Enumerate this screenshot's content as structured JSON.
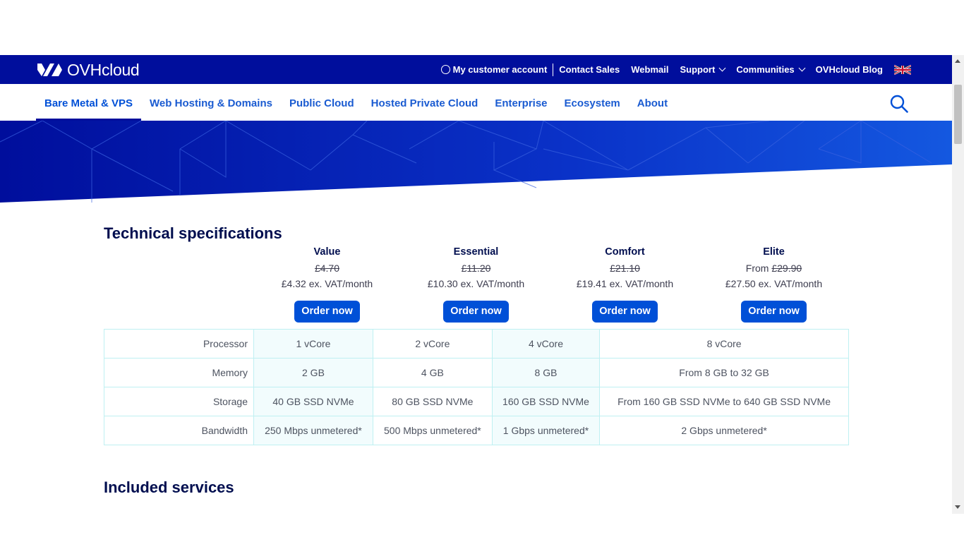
{
  "brand": {
    "name": "OVHcloud"
  },
  "topbar": {
    "links": [
      {
        "label": "My customer account",
        "icon": "user-circle-icon"
      },
      {
        "label": "Contact Sales"
      },
      {
        "label": "Webmail"
      },
      {
        "label": "Support",
        "dropdown": true
      },
      {
        "label": "Communities",
        "dropdown": true
      },
      {
        "label": "OVHcloud Blog"
      }
    ],
    "language_icon": "uk-flag-icon"
  },
  "mainnav": {
    "items": [
      {
        "label": "Bare Metal & VPS",
        "active": true
      },
      {
        "label": "Web Hosting & Domains"
      },
      {
        "label": "Public Cloud"
      },
      {
        "label": "Hosted Private Cloud"
      },
      {
        "label": "Enterprise"
      },
      {
        "label": "Ecosystem"
      },
      {
        "label": "About"
      }
    ],
    "search_icon": "search-icon"
  },
  "specs": {
    "title": "Technical specifications",
    "plans": [
      {
        "name": "Value",
        "old_prefix": "",
        "old_price": "£4.70",
        "price": "£4.32 ex. VAT/month",
        "button": "Order now"
      },
      {
        "name": "Essential",
        "old_prefix": "",
        "old_price": "£11.20",
        "price": "£10.30 ex. VAT/month",
        "button": "Order now"
      },
      {
        "name": "Comfort",
        "old_prefix": "",
        "old_price": "£21.10",
        "price": "£19.41 ex. VAT/month",
        "button": "Order now"
      },
      {
        "name": "Elite",
        "old_prefix": "From ",
        "old_price": "£29.90",
        "price": "£27.50 ex. VAT/month",
        "button": "Order now"
      }
    ],
    "rows": [
      {
        "label": "Processor",
        "values": [
          "1 vCore",
          "2 vCore",
          "4 vCore",
          "8 vCore"
        ]
      },
      {
        "label": "Memory",
        "values": [
          "2 GB",
          "4 GB",
          "8 GB",
          "From 8 GB to 32 GB"
        ]
      },
      {
        "label": "Storage",
        "values": [
          "40 GB SSD NVMe",
          "80 GB SSD NVMe",
          "160 GB SSD NVMe",
          "From 160 GB SSD NVMe to 640 GB SSD NVMe"
        ]
      },
      {
        "label": "Bandwidth",
        "values": [
          "250 Mbps unmetered*",
          "500 Mbps unmetered*",
          "1 Gbps unmetered*",
          "2 Gbps unmetered*"
        ]
      }
    ]
  },
  "included": {
    "title": "Included services"
  },
  "colors": {
    "brand_navy": "#000e9c",
    "link_blue": "#0050d7",
    "table_border": "#bff0f2",
    "table_shade": "#f2fcfd"
  }
}
